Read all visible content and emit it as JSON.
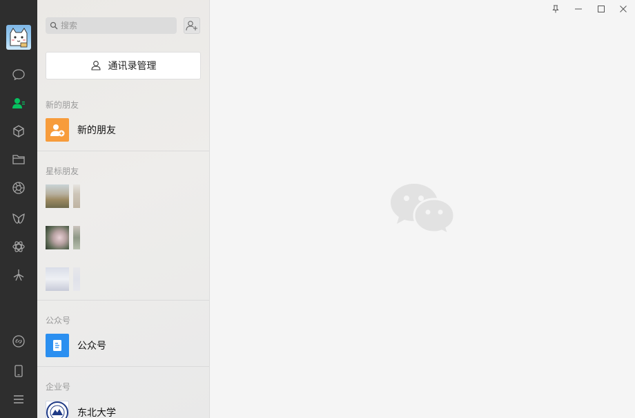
{
  "sidebar": {
    "icons": [
      {
        "name": "chat-icon"
      },
      {
        "name": "contacts-icon"
      },
      {
        "name": "favorites-cube-icon"
      },
      {
        "name": "folder-icon"
      },
      {
        "name": "moments-aperture-icon"
      },
      {
        "name": "channels-icon"
      },
      {
        "name": "mini-programs-icon"
      },
      {
        "name": "search-spark-icon"
      },
      {
        "name": "mini-program-link-icon"
      },
      {
        "name": "phone-icon"
      },
      {
        "name": "menu-icon"
      }
    ],
    "active_color": "#07c160"
  },
  "search": {
    "placeholder": "搜索"
  },
  "contacts": {
    "manage_label": "通讯录管理",
    "new_friends_section": "新的朋友",
    "new_friends_item": "新的朋友",
    "starred_section": "星标朋友",
    "official_section": "公众号",
    "official_item": "公众号",
    "enterprise_section": "企业号",
    "enterprise_item": "东北大学"
  },
  "colors": {
    "new_friend_icon_bg": "#f79c3c",
    "official_icon_bg": "#2b8ff0"
  }
}
